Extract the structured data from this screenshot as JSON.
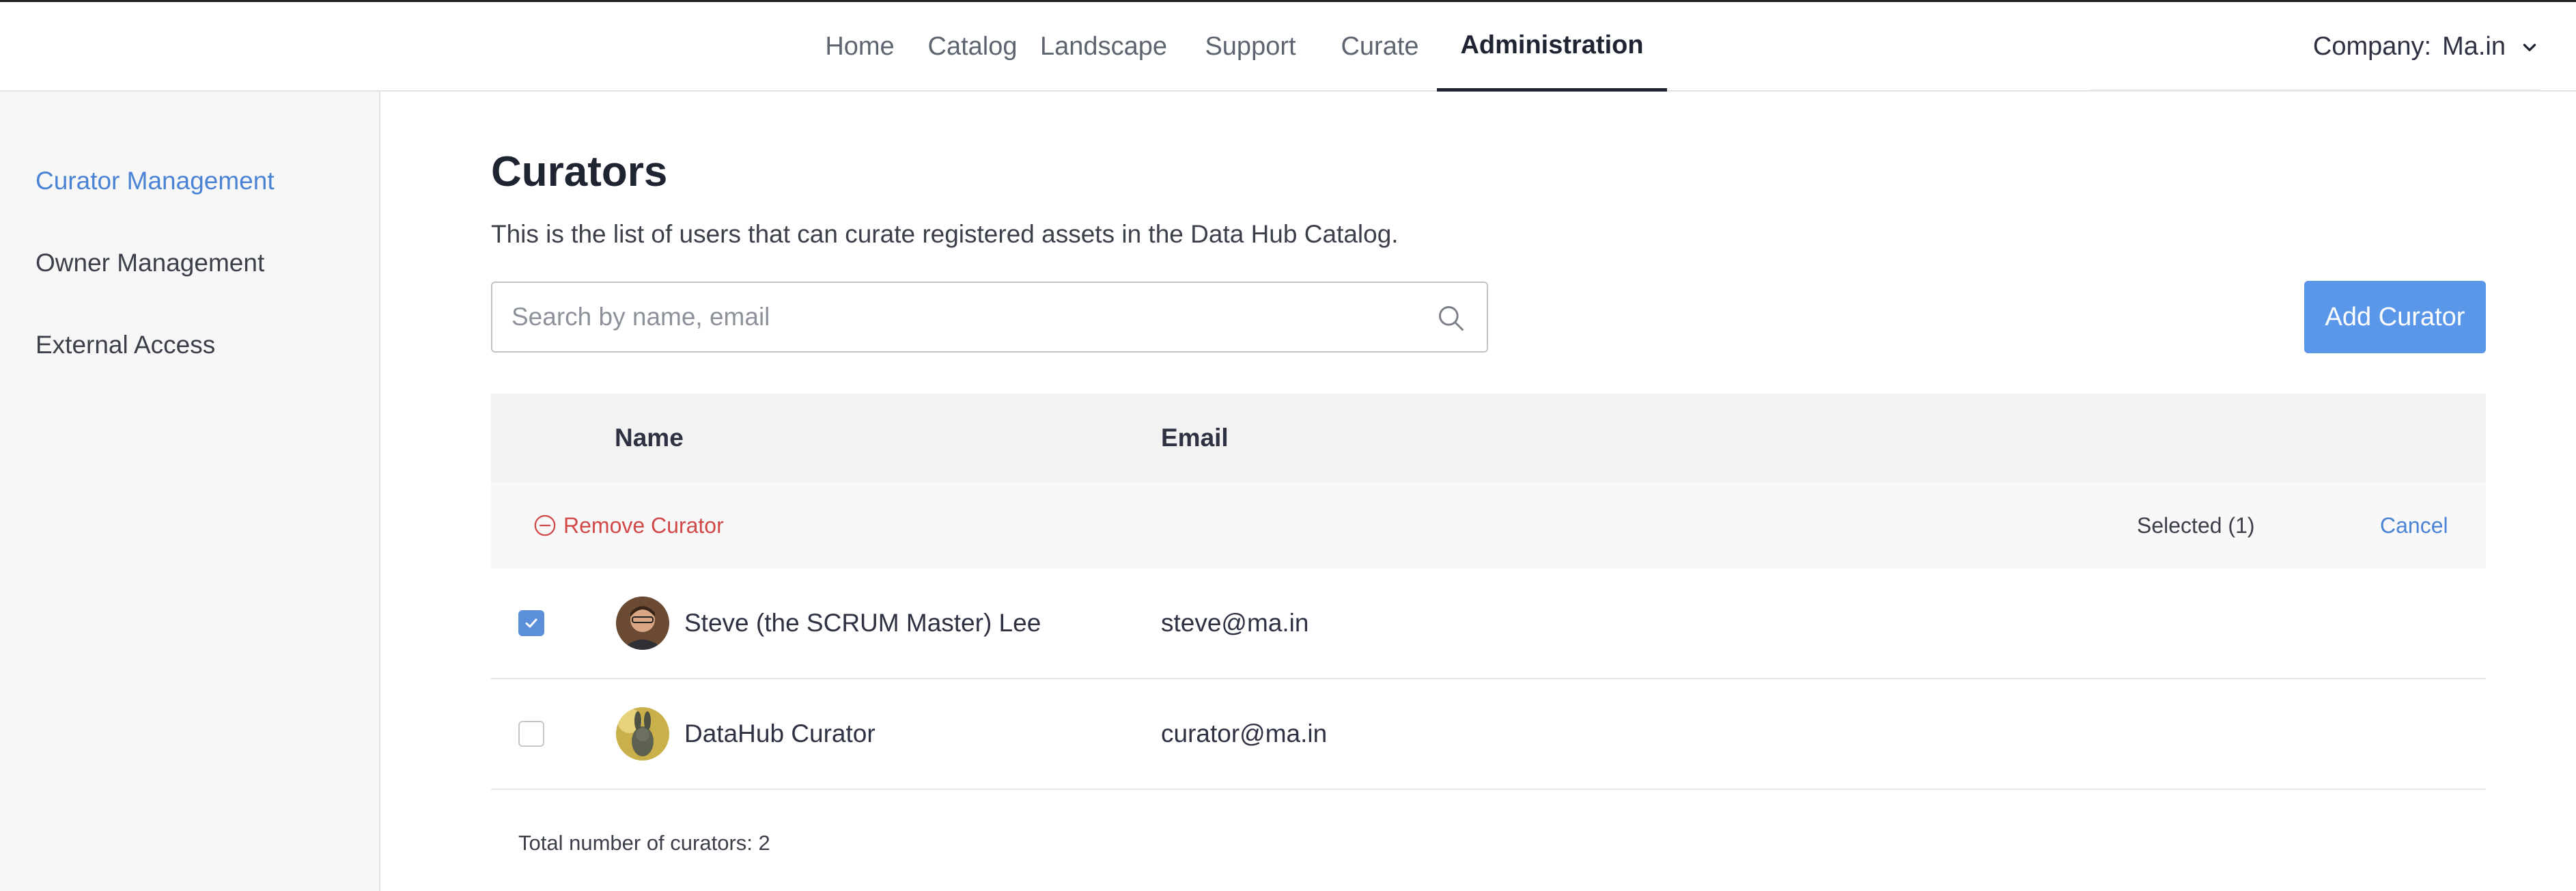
{
  "nav": {
    "items": [
      {
        "label": "Home"
      },
      {
        "label": "Catalog"
      },
      {
        "label": "Landscape"
      },
      {
        "label": "Support"
      },
      {
        "label": "Curate"
      },
      {
        "label": "Administration",
        "active": true
      }
    ]
  },
  "company": {
    "label": "Company:",
    "value": "Ma.in",
    "icon": "chevron-down-icon"
  },
  "sidebar": {
    "items": [
      {
        "label": "Curator Management",
        "active": true
      },
      {
        "label": "Owner Management"
      },
      {
        "label": "External Access"
      }
    ]
  },
  "page": {
    "title": "Curators",
    "description": "This is the list of users that can curate registered assets in the Data Hub Catalog."
  },
  "search": {
    "placeholder": "Search by name, email",
    "value": "",
    "icon": "search-icon"
  },
  "add_button": {
    "label": "Add Curator"
  },
  "table": {
    "headers": {
      "name": "Name",
      "email": "Email"
    },
    "actions": {
      "remove_label": "Remove Curator",
      "remove_icon": "minus-circle-icon",
      "selected_text": "Selected (1)",
      "cancel_label": "Cancel"
    },
    "rows": [
      {
        "name": "Steve (the SCRUM Master) Lee",
        "email": "steve@ma.in",
        "checked": true
      },
      {
        "name": "DataHub Curator",
        "email": "curator@ma.in",
        "checked": false
      }
    ],
    "total_text": "Total number of curators: 2"
  },
  "colors": {
    "accent": "#5b97e8",
    "link": "#4a83d4",
    "danger": "#d04848"
  }
}
